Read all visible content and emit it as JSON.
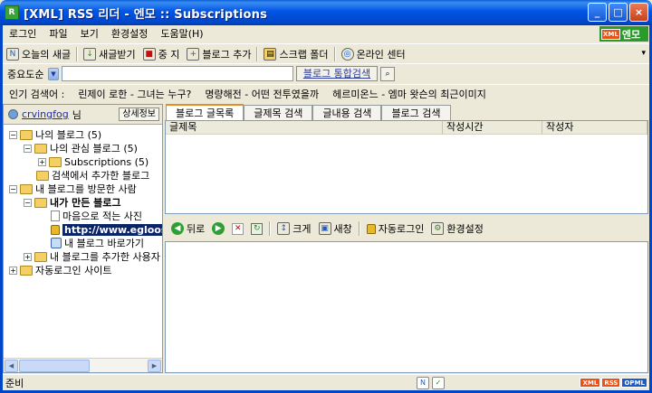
{
  "window": {
    "title": "[XML] RSS 리더 - 엔모 :: Subscriptions",
    "app_icon": "rss-app-icon",
    "minimize_label": "_",
    "maximize_label": "□",
    "close_label": "×"
  },
  "menu": {
    "items": [
      "로그인",
      "파일",
      "보기",
      "환경설정",
      "도움말(H)"
    ],
    "logo_badge": "XML",
    "logo_text": "엔모"
  },
  "toolbar": {
    "buttons": [
      {
        "icon": "N",
        "label": "오늘의 새글"
      },
      {
        "icon": "↓",
        "label": "새글받기"
      },
      {
        "icon": "■",
        "label": "중 지"
      },
      {
        "icon": "+",
        "label": "블로그 추가"
      },
      {
        "icon": "▤",
        "label": "스크랩 폴더"
      },
      {
        "icon": "◎",
        "label": "온라인 센터"
      }
    ],
    "overflow": "▾"
  },
  "search": {
    "scope": "중요도순",
    "value": "",
    "button": "블로그 통합검색"
  },
  "popular": {
    "label": "인기 검색어 :",
    "items": [
      "린제이 로한 - 그녀는 누구?",
      "명량해전 - 어떤 전투였을까",
      "헤르미온느 - 엠마 왓슨의 최근이미지"
    ]
  },
  "user": {
    "name": "crvingfog",
    "suffix": "님",
    "info_button": "상세정보"
  },
  "tree": {
    "nodes": [
      {
        "expander": "−",
        "label": "나의 블로그 (5)"
      },
      {
        "expander": "−",
        "label": "나의 관심 블로그 (5)"
      },
      {
        "expander": "+",
        "label": "Subscriptions (5)"
      },
      {
        "expander": "",
        "label": "검색에서 추가한 블로그"
      },
      {
        "expander": "−",
        "label": "내 블로그를 방문한 사람"
      },
      {
        "expander": "−",
        "label": "내가 만든 블로그"
      },
      {
        "expander": "",
        "label": "마음으로 적는 사진"
      },
      {
        "expander": "",
        "label": "http://www.egloos"
      },
      {
        "expander": "",
        "label": "내 블로그 바로가기"
      },
      {
        "expander": "+",
        "label": "내 블로그를 추가한 사용자"
      },
      {
        "expander": "+",
        "label": "자동로그인 사이트"
      }
    ]
  },
  "tabs": [
    "블로그 글목록",
    "글제목 검색",
    "글내용 검색",
    "블로그 검색"
  ],
  "list": {
    "columns": [
      "글제목",
      "작성시간",
      "작성자"
    ]
  },
  "nav": {
    "back": "뒤로",
    "zoom": "크게",
    "new_window": "새창",
    "auto_login": "자동로그인",
    "settings": "환경설정"
  },
  "status": {
    "text": "준비",
    "badges": [
      "XML",
      "RSS",
      "OPML"
    ]
  },
  "colors": {
    "titlebar": "#0055e5",
    "active_tab": "#e68b2c",
    "brand_green": "#2a9a2a"
  }
}
